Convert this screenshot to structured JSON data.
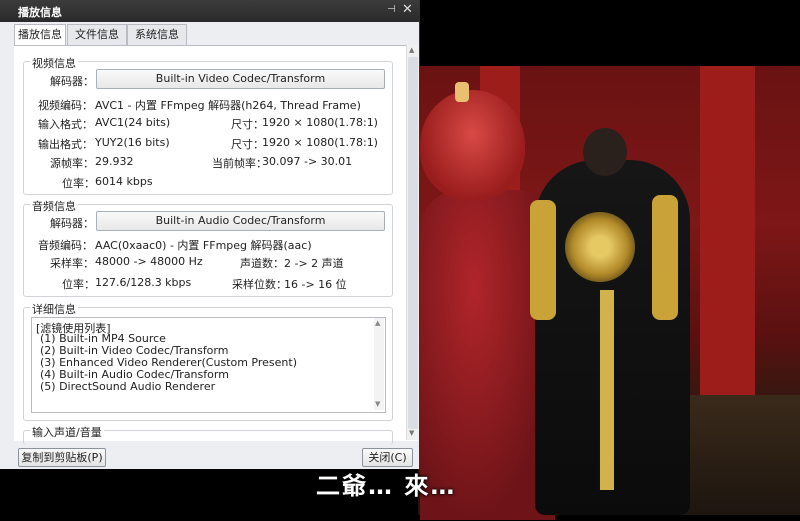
{
  "window": {
    "title": "播放信息",
    "pin_icon": "pin-icon",
    "close_icon": "close-icon"
  },
  "tabs": [
    "播放信息",
    "文件信息",
    "系统信息"
  ],
  "video": {
    "group_title": "视频信息",
    "decoder_label": "解码器：",
    "decoder_button": "Built-in Video Codec/Transform",
    "codec_label": "视频编码：",
    "codec_value": "AVC1 - 内置 FFmpeg 解码器(h264, Thread Frame)",
    "input_label": "输入格式：",
    "input_value": "AVC1(24 bits)",
    "input_size_label": "尺寸：",
    "input_size_value": "1920 × 1080(1.78:1)",
    "output_label": "输出格式：",
    "output_value": "YUY2(16 bits)",
    "output_size_label": "尺寸：",
    "output_size_value": "1920 × 1080(1.78:1)",
    "src_fps_label": "源帧率：",
    "src_fps_value": "29.932",
    "cur_fps_label": "当前帧率：",
    "cur_fps_value": "30.097 -> 30.01",
    "bitrate_label": "位率：",
    "bitrate_value": "6014 kbps"
  },
  "audio": {
    "group_title": "音频信息",
    "decoder_label": "解码器：",
    "decoder_button": "Built-in Audio Codec/Transform",
    "codec_label": "音频编码：",
    "codec_value": "AAC(0xaac0) - 内置 FFmpeg 解码器(aac)",
    "samplerate_label": "采样率：",
    "samplerate_value": "48000 -> 48000 Hz",
    "channels_label": "声道数：",
    "channels_value": "2 -> 2 声道",
    "bitrate_label": "位率：",
    "bitrate_value": "127.6/128.3 kbps",
    "bits_label": "采样位数：",
    "bits_value": "16 -> 16 位"
  },
  "details": {
    "group_title": "详细信息",
    "lines": [
      "[滤镜使用列表]",
      "(1) Built-in MP4 Source",
      "(2) Built-in Video Codec/Transform",
      "(3) Enhanced Video Renderer(Custom Present)",
      "(4) Built-in Audio Codec/Transform",
      "(5) DirectSound Audio Renderer"
    ]
  },
  "input_channel": {
    "group_title": "输入声道/音量"
  },
  "buttons": {
    "copy": "复制到剪贴板(P)",
    "close": "关闭(C)"
  },
  "subtitle": "二爺… 來…"
}
